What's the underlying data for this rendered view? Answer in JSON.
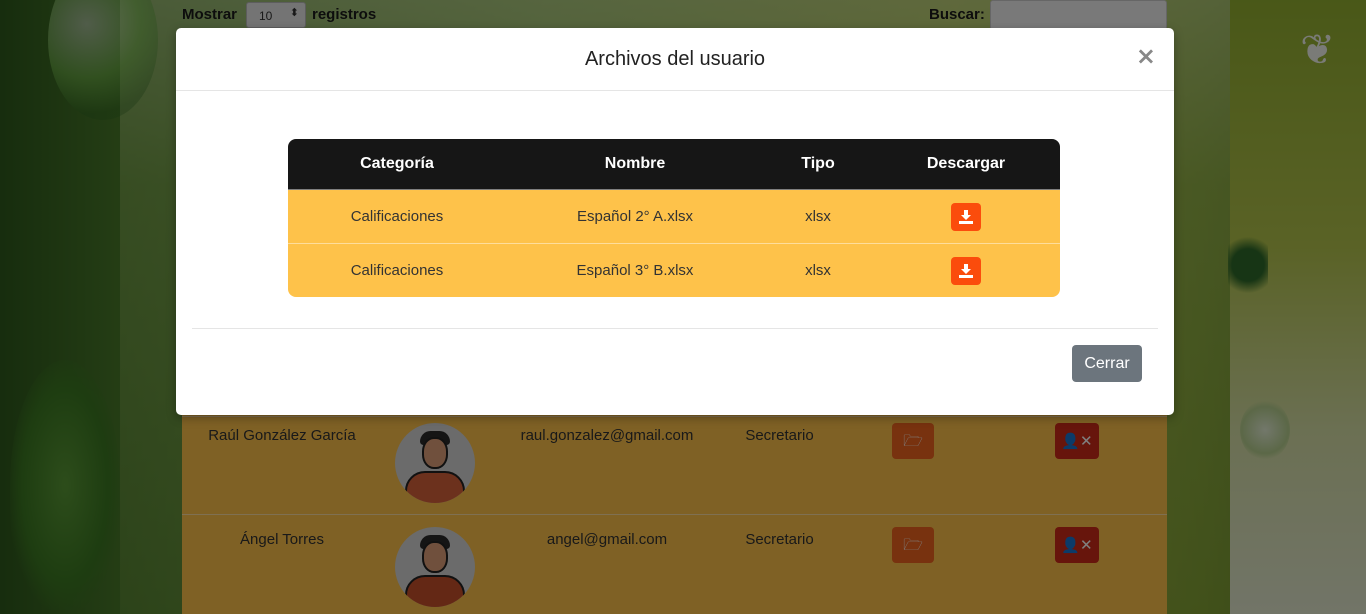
{
  "page": {
    "length_label": "Mostrar",
    "length_value": "10",
    "length_suffix": "registros",
    "search_label": "Buscar:",
    "search_value": ""
  },
  "users": [
    {
      "name": "Raúl González García",
      "email": "raul.gonzalez@gmail.com",
      "role": "Secretario"
    },
    {
      "name": "Ángel Torres",
      "email": "angel@gmail.com",
      "role": "Secretario"
    }
  ],
  "modal": {
    "title": "Archivos del usuario",
    "close_symbol": "×",
    "columns": [
      "Categoría",
      "Nombre",
      "Tipo",
      "Descargar"
    ],
    "rows": [
      {
        "category": "Calificaciones",
        "name": "Español 2° A.xlsx",
        "type": "xlsx"
      },
      {
        "category": "Calificaciones",
        "name": "Español 3° B.xlsx",
        "type": "xlsx"
      }
    ],
    "close_button": "Cerrar"
  },
  "icons": {
    "download": "download-icon",
    "folder": "folder-open-icon",
    "user_delete": "user-times-icon",
    "close": "close-icon"
  },
  "colors": {
    "table_row": "#fec24a",
    "table_header": "#161616",
    "download_button": "#fb4c0c",
    "close_button": "#6c757d",
    "files_button": "#f0641e",
    "delete_button": "#cf2a18"
  }
}
